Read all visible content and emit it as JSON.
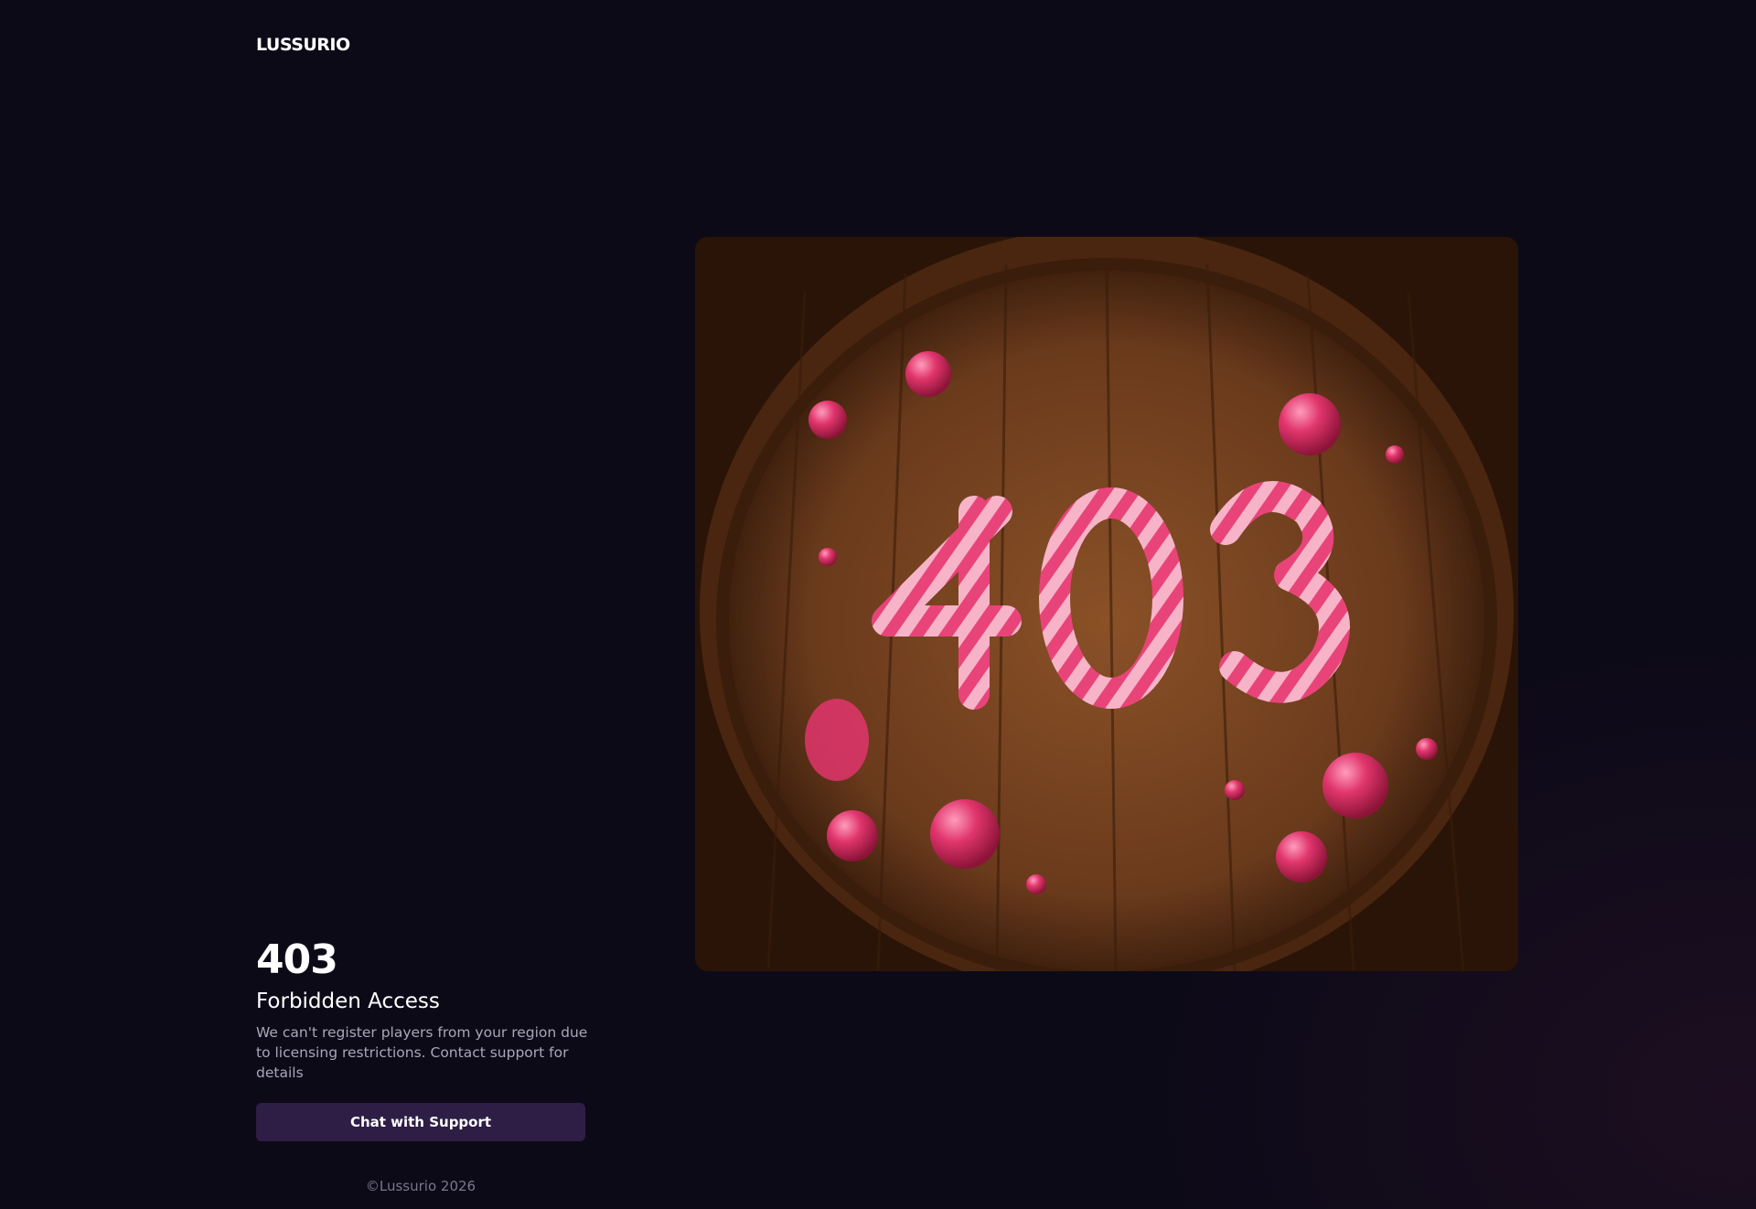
{
  "header": {
    "logo_text": "LUSSURIO"
  },
  "hero_image": {
    "alt": "403",
    "digits": "403"
  },
  "error": {
    "code": "403",
    "title": "Forbidden Access",
    "description": "We can't register players from your region due to licensing restrictions. Contact support for details"
  },
  "actions": {
    "support_label": "Chat with Support"
  },
  "footer": {
    "copyright": "©Lussurio 2026"
  },
  "colors": {
    "background": "#0d0a18",
    "button": "#2e1d45",
    "candy_pink": "#e8447a",
    "candy_light": "#f7b4c8",
    "wood": "#6a3a1c"
  }
}
